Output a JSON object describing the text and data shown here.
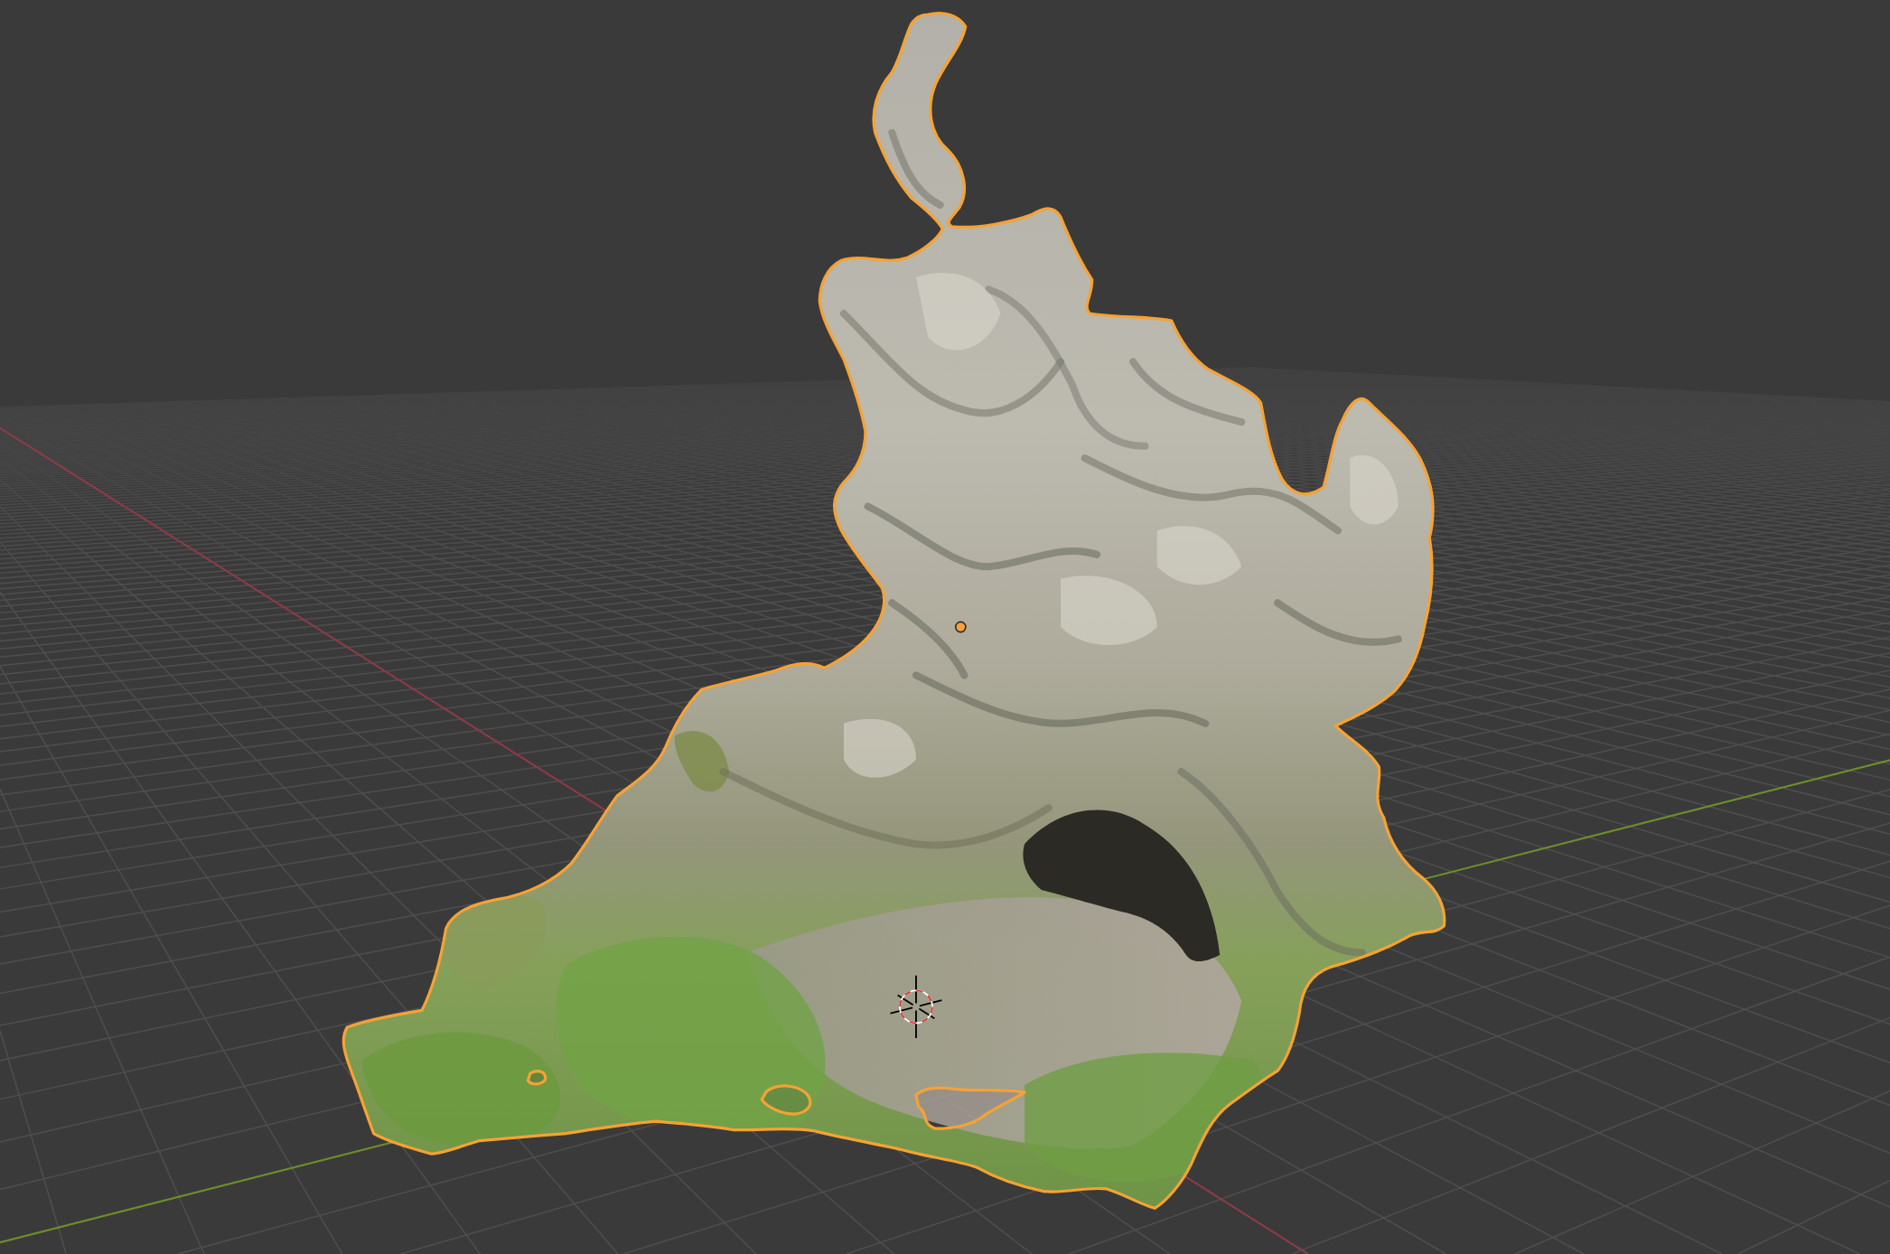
{
  "viewport": {
    "object": {
      "selected": true,
      "active": true
    }
  }
}
